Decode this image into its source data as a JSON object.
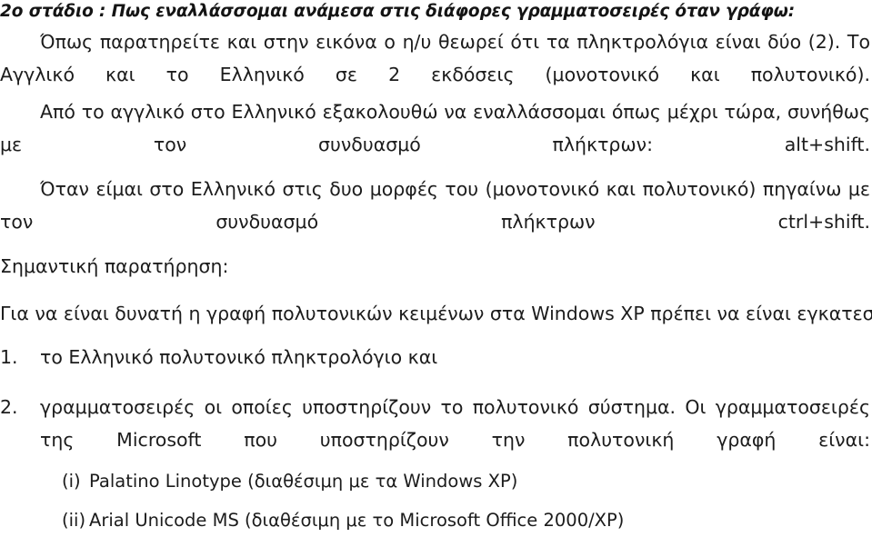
{
  "document": {
    "language": "el",
    "background_color": "#ffffff",
    "text_color": "#1c1c1c",
    "heading": "2ο στάδιο : Πως εναλλάσσομαι ανάμεσα στις διάφορες γραμματοσειρές όταν γράφω:",
    "paragraphs": [
      "Όπως παρατηρείτε και στην εικόνα ο η/υ θεωρεί ότι τα πληκτρολόγια είναι δύο (2). Το Αγγλικό και το Ελληνικό σε 2 εκδόσεις (μονοτονικό και πολυτονικό).",
      "Από το αγγλικό στο Ελληνικό εξακολουθώ να εναλλάσσομαι όπως μέχρι τώρα, συνήθως με τον συνδυασμό πλήκτρων: alt+shift.",
      "Όταν είμαι στο Ελληνικό στις δυο μορφές του (μονοτονικό και πολυτονικό) πηγαίνω με τον συνδυασμό πλήκτρων ctrl+shift."
    ],
    "note": {
      "title": "Σημαντική παρατήρηση:",
      "lead": "Για να είναι δυνατή η γραφή πολυτονικών κειμένων στα Windows XP πρέπει να είναι εγκατεστημένο:"
    },
    "numbered_list": [
      {
        "marker": "1.",
        "text": "το Ελληνικό πολυτονικό πληκτρολόγιο και"
      },
      {
        "marker": "2.",
        "text": "γραμματοσειρές οι οποίες υποστηρίζουν το πολυτονικό σύστημα. Οι γραμματοσειρές της Microsoft που υποστηρίζουν την πολυτονική γραφή είναι:"
      }
    ],
    "sub_items": [
      {
        "marker": "(i)",
        "text": "Palatino Linotype (διαθέσιμη με τα Windows XP)"
      },
      {
        "marker": "(ii)",
        "text": "Arial Unicode MS (διαθέσιμη με το Microsoft Office 2000/XP)"
      }
    ]
  }
}
